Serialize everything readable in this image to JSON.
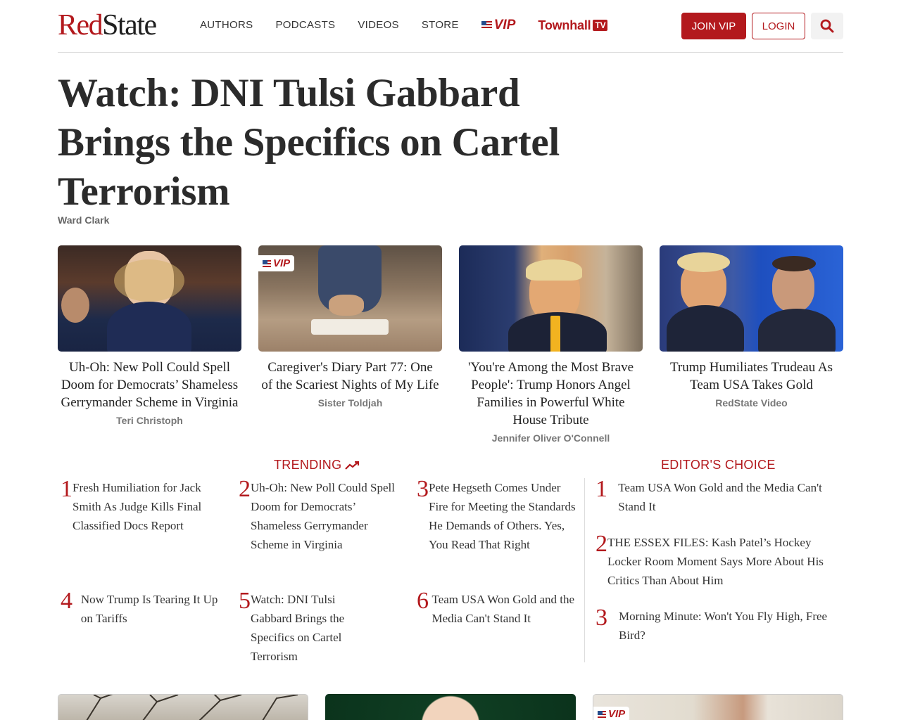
{
  "header": {
    "logo_red": "Red",
    "logo_black": "State",
    "nav": [
      "AUTHORS",
      "PODCASTS",
      "VIDEOS",
      "STORE"
    ],
    "vip_label": "VIP",
    "townhall_label": "Townhall",
    "townhall_tv": "TV",
    "join_label": "JOIN VIP",
    "login_label": "LOGIN"
  },
  "article": {
    "headline": "Watch: DNI Tulsi Gabbard Brings the Specifics on Cartel Terrorism",
    "author": "Ward Clark"
  },
  "cards": [
    {
      "title": "Uh-Oh: New Poll Could Spell Doom for Democrats’ Shameless Gerrymander Scheme in Virginia",
      "author": "Teri Christoph",
      "vip": false
    },
    {
      "title": "Caregiver's Diary Part 77: One of the Scariest Nights of My Life",
      "author": "Sister Toldjah",
      "vip": true,
      "vip_label": "VIP"
    },
    {
      "title": "'You're Among the Most Brave People': Trump Honors Angel Families in Powerful White House Tribute",
      "author": "Jennifer Oliver O'Connell",
      "vip": false
    },
    {
      "title": "Trump Humiliates Trudeau As Team USA Takes Gold",
      "author": "RedState Video",
      "vip": false
    }
  ],
  "trending": {
    "heading": "TRENDING",
    "items": [
      {
        "num": "1",
        "text": "Fresh Humiliation for Jack Smith As Judge Kills Final Classified Docs Report"
      },
      {
        "num": "2",
        "text": "Uh-Oh: New Poll Could Spell Doom for Democrats’ Shameless Gerrymander Scheme in Virginia"
      },
      {
        "num": "3",
        "text": "Pete Hegseth Comes Under Fire for Meeting the Standards He Demands of Others. Yes, You Read That Right"
      },
      {
        "num": "4",
        "text": "Now Trump Is Tearing It Up on Tariffs"
      },
      {
        "num": "5",
        "text": "Watch: DNI Tulsi Gabbard Brings the Specifics on Cartel Terrorism"
      },
      {
        "num": "6",
        "text": "Team USA Won Gold and the Media Can't Stand It"
      }
    ]
  },
  "editors_choice": {
    "heading": "EDITOR'S CHOICE",
    "items": [
      {
        "num": "1",
        "text": "Team USA Won Gold and the Media Can't Stand It"
      },
      {
        "num": "2",
        "text": "THE ESSEX FILES: Kash Patel’s Hockey Locker Room Moment Says More About His Critics Than About Him"
      },
      {
        "num": "3",
        "text": "Morning Minute: Won't You Fly High, Free Bird?"
      }
    ]
  },
  "bottom_cards": {
    "vip_label": "VIP"
  },
  "colors": {
    "brand_red": "#b3191d",
    "flag_blue": "#274d8c"
  },
  "icons": [
    "search-icon",
    "trending-up-icon",
    "us-flag-icon"
  ]
}
